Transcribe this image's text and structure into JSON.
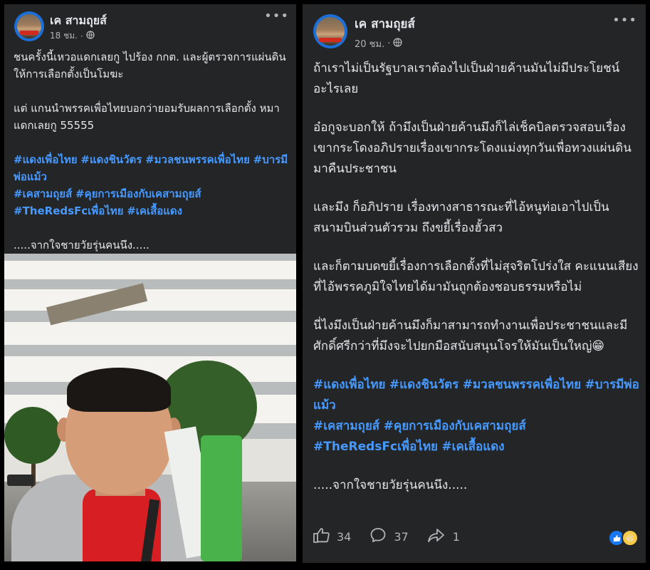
{
  "left_post": {
    "author": "เค สามถุยส์",
    "time": "18 ชม.",
    "paragraphs": [
      "ชนครั้งนี้เหวอแดกเลยกู  ไปร้อง กกต. และผู้ตรวจการแผ่นดิน ให้การเลือกตั้งเป็นโมฆะ",
      "แต่ แกนนำพรรคเพื่อไทยบอกว่ายอมรับผลการเลือกตั้ง หมาแดกเลยกู 55555"
    ],
    "hashtags": [
      [
        "#แดงเพื่อไทย",
        "#แดงชินวัตร",
        "#มวลชนพรรคเพื่อไทย",
        "#บารมีพ่อแม้ว"
      ],
      [
        "#เคสามถุยส์",
        "#คุยการเมืองกับเคสามถุยส์"
      ],
      [
        "#TheRedsFcเพื่อไทย",
        "#เคเสื้อแดง"
      ]
    ],
    "signature": ".....จากใจชายวัยรุ่นคนนึง....."
  },
  "right_post": {
    "author": "เค สามถุยส์",
    "time": "20 ชม.",
    "paragraphs": [
      "ถ้าเราไม่เป็นรัฐบาลเราต้องไปเป็นฝ่ายค้านมันไม่มีประโยชน์อะไรเลย",
      "อ๋อกูจะบอกให้ ถ้ามึงเป็นฝ่ายค้านมึงก็ไล่เช็คบิลตรวจสอบเรื่องเขากระโดงอภิปรายเรื่องเขากระโดงแม่งทุกวันเพื่อทวงแผ่นดินมาคืนประชาชน",
      "และมึง ก็อภิปราย เรื่องทางสาธารณะที่ไอ้หนูท่อเอาไปเป็นสนามบินส่วนตัวรวม ถึงขยี้เรื่องฮั้วสว",
      "และก็ตามบดขยี้เรื่องการเลือกตั้งที่ไม่สุจริตโปร่งใส คะแนนเสียงที่ไอ้พรรคภูมิใจไทยได้มามันถูกต้องชอบธรรมหรือไม่",
      "นี่ไงมึงเป็นฝ่ายค้านมึงก็มาสามารถทำงานเพื่อประชาชนและมีศักดิ์ศรีกว่าที่มึงจะไปยกมือสนับสนุนโจรให้มันเป็นใหญ่😁"
    ],
    "hashtags": [
      [
        "#แดงเพื่อไทย",
        "#แดงชินวัตร",
        "#มวลชนพรรคเพื่อไทย",
        "#บารมีพ่อแม้ว"
      ],
      [
        "#เคสามถุยส์",
        "#คุยการเมืองกับเคสามถุยส์"
      ],
      [
        "#TheRedsFcเพื่อไทย",
        "#เคเสื้อแดง"
      ]
    ],
    "signature": ".....จากใจชายวัยรุ่นคนนึง.....",
    "likes": "34",
    "comments": "37",
    "shares": "1"
  },
  "colors": {
    "hashtag": "#4599ff",
    "card": "#242526",
    "text": "#e4e6eb",
    "muted": "#b0b3b8"
  },
  "icons": [
    "globe-icon",
    "more-icon",
    "like-icon",
    "comment-icon",
    "share-icon",
    "like-reaction-icon",
    "haha-reaction-icon"
  ]
}
